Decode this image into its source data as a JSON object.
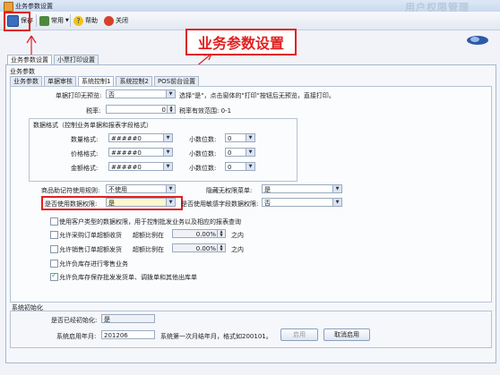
{
  "window": {
    "title": "业务参数设置",
    "watermark": "用户权限管理"
  },
  "toolbar": {
    "save": "保存",
    "common": "常用",
    "help": "帮助",
    "close": "关闭"
  },
  "banner": "业务参数设置",
  "tabs_outer": [
    "业务参数设置",
    "小票打印设置"
  ],
  "group_title": "业务参数",
  "tabs_inner": [
    "业务参数",
    "单据审核",
    "系统控制1",
    "系统控制2",
    "POS前台设置"
  ],
  "form": {
    "print_preview_label": "单据打印无预览:",
    "print_preview_value": "否",
    "print_preview_hint": "选择\"是\"，点击窗体的\"打印\"按钮后无预览，直接打印。",
    "tax_label": "税率:",
    "tax_value": "0",
    "tax_hint": "税率有效范围: 0-1",
    "data_format_title": "数据格式（控制业务单据和报表字段格式）",
    "qty_format_label": "数量格式:",
    "qty_format_value": "#####0",
    "price_format_label": "价格格式:",
    "price_format_value": "#####0",
    "amount_format_label": "金额格式:",
    "amount_format_value": "#####0",
    "decimals_label": "小数位数:",
    "qty_decimals": "0",
    "price_decimals": "0",
    "amount_decimals": "0",
    "mnemonic_label": "商品助记符使用规则:",
    "mnemonic_value": "不使用",
    "hide_menu_label": "隐藏无权限菜单:",
    "hide_menu_value": "是",
    "use_data_perm_label": "是否使用数据权限:",
    "use_data_perm_value": "是",
    "use_sensitive_label": "是否使用敏感字段数据权限:",
    "use_sensitive_value": "否",
    "chk_customer_perm": "使用客户类型的数据权限，用于控制批发业务以及相应的报表查询",
    "chk_purchase_over": "允许采购订单超额收货",
    "chk_sales_over": "允许销售订单超额发货",
    "over_ratio_label": "超额比例在",
    "over_ratio_1": "0.00%",
    "over_ratio_2": "0.00%",
    "within": "之内",
    "chk_negative_zero": "允许负库存进行零售业务",
    "chk_negative_wholesale": "允许负库存保存批发发货单、调拨单和其他出库单"
  },
  "init": {
    "title": "系统初始化",
    "initialized_label": "是否已经初始化:",
    "initialized_value": "是",
    "start_month_label": "系统启用年月:",
    "start_month_value": "201206",
    "start_month_hint": "系统第一次月结年月，格式如200101。",
    "enable_button": "启用",
    "cancel_enable_button": "取消启用"
  },
  "colors": {
    "annotation_red": "#e02020",
    "accent": "#2a5db0"
  }
}
